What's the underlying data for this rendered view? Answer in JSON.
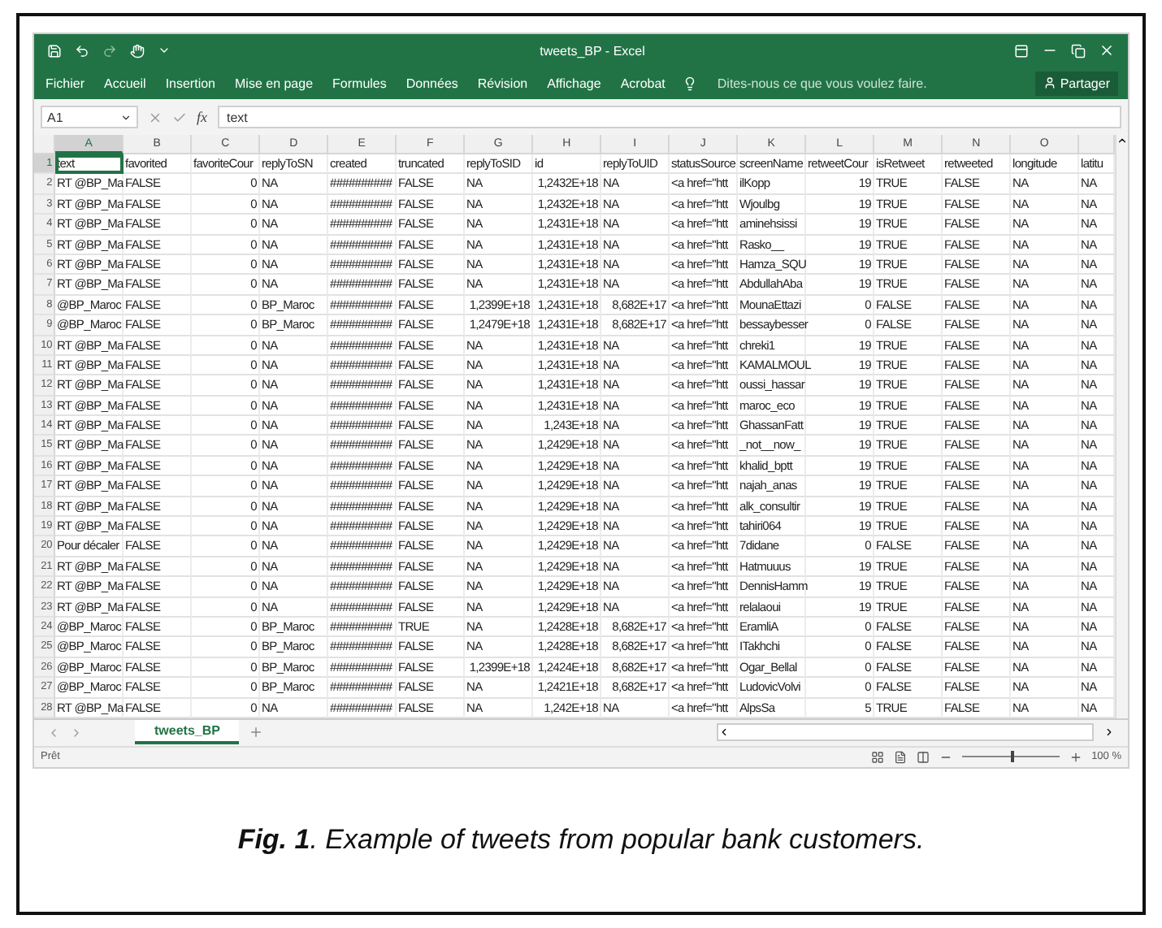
{
  "window": {
    "title": "tweets_BP - Excel"
  },
  "ribbon_tabs": [
    {
      "label": "Fichier",
      "selected": false
    },
    {
      "label": "Accueil",
      "selected": false
    },
    {
      "label": "Insertion",
      "selected": false
    },
    {
      "label": "Mise en page",
      "selected": false
    },
    {
      "label": "Formules",
      "selected": false
    },
    {
      "label": "Données",
      "selected": false
    },
    {
      "label": "Révision",
      "selected": false
    },
    {
      "label": "Affichage",
      "selected": false
    },
    {
      "label": "Acrobat",
      "selected": false
    }
  ],
  "tell_me": {
    "placeholder": "Dites-nous ce que vous voulez faire."
  },
  "share": "Partager",
  "formula_bar": {
    "name_box": "A1",
    "fx": "fx",
    "value": "text"
  },
  "columns": [
    {
      "label": "A",
      "selected": true
    },
    {
      "label": "B",
      "selected": false
    },
    {
      "label": "C",
      "selected": false
    },
    {
      "label": "D",
      "selected": false
    },
    {
      "label": "E",
      "selected": false
    },
    {
      "label": "F",
      "selected": false
    },
    {
      "label": "G",
      "selected": false
    },
    {
      "label": "H",
      "selected": false
    },
    {
      "label": "I",
      "selected": false
    },
    {
      "label": "J",
      "selected": false
    },
    {
      "label": "K",
      "selected": false
    },
    {
      "label": "L",
      "selected": false
    },
    {
      "label": "M",
      "selected": false
    },
    {
      "label": "N",
      "selected": false
    },
    {
      "label": "O",
      "selected": false
    }
  ],
  "rows": [
    {
      "number": "1",
      "selected": true,
      "cells": [
        "text",
        "favorited",
        "favoriteCour",
        "replyToSN",
        "created",
        "truncated",
        "replyToSID",
        "id",
        "replyToUID",
        "statusSource",
        "screenName",
        "retweetCour",
        "isRetweet",
        "retweeted",
        "longitude",
        "latitu"
      ]
    },
    {
      "number": "2",
      "selected": false,
      "cells": [
        "RT @BP_Ma",
        "FALSE",
        "0",
        "NA",
        "##########",
        "FALSE",
        "NA",
        "1,2432E+18",
        "NA",
        "<a href=\"htt",
        "ilKopp",
        "19",
        "TRUE",
        "FALSE",
        "NA",
        "NA"
      ]
    },
    {
      "number": "3",
      "selected": false,
      "cells": [
        "RT @BP_Ma",
        "FALSE",
        "0",
        "NA",
        "##########",
        "FALSE",
        "NA",
        "1,2432E+18",
        "NA",
        "<a href=\"htt",
        "Wjoulbg",
        "19",
        "TRUE",
        "FALSE",
        "NA",
        "NA"
      ]
    },
    {
      "number": "4",
      "selected": false,
      "cells": [
        "RT @BP_Ma",
        "FALSE",
        "0",
        "NA",
        "##########",
        "FALSE",
        "NA",
        "1,2431E+18",
        "NA",
        "<a href=\"htt",
        "aminehsissi",
        "19",
        "TRUE",
        "FALSE",
        "NA",
        "NA"
      ]
    },
    {
      "number": "5",
      "selected": false,
      "cells": [
        "RT @BP_Ma",
        "FALSE",
        "0",
        "NA",
        "##########",
        "FALSE",
        "NA",
        "1,2431E+18",
        "NA",
        "<a href=\"htt",
        "Rasko__",
        "19",
        "TRUE",
        "FALSE",
        "NA",
        "NA"
      ]
    },
    {
      "number": "6",
      "selected": false,
      "cells": [
        "RT @BP_Ma",
        "FALSE",
        "0",
        "NA",
        "##########",
        "FALSE",
        "NA",
        "1,2431E+18",
        "NA",
        "<a href=\"htt",
        "Hamza_SQU",
        "19",
        "TRUE",
        "FALSE",
        "NA",
        "NA"
      ]
    },
    {
      "number": "7",
      "selected": false,
      "cells": [
        "RT @BP_Ma",
        "FALSE",
        "0",
        "NA",
        "##########",
        "FALSE",
        "NA",
        "1,2431E+18",
        "NA",
        "<a href=\"htt",
        "AbdullahAba",
        "19",
        "TRUE",
        "FALSE",
        "NA",
        "NA"
      ]
    },
    {
      "number": "8",
      "selected": false,
      "cells": [
        "@BP_Maroc",
        "FALSE",
        "0",
        "BP_Maroc",
        "##########",
        "FALSE",
        "1,2399E+18",
        "1,2431E+18",
        "8,682E+17",
        "<a href=\"htt",
        "MounaEttazi",
        "0",
        "FALSE",
        "FALSE",
        "NA",
        "NA"
      ]
    },
    {
      "number": "9",
      "selected": false,
      "cells": [
        "@BP_Maroc",
        "FALSE",
        "0",
        "BP_Maroc",
        "##########",
        "FALSE",
        "1,2479E+18",
        "1,2431E+18",
        "8,682E+17",
        "<a href=\"htt",
        "bessaybesser",
        "0",
        "FALSE",
        "FALSE",
        "NA",
        "NA"
      ]
    },
    {
      "number": "10",
      "selected": false,
      "cells": [
        "RT @BP_Ma",
        "FALSE",
        "0",
        "NA",
        "##########",
        "FALSE",
        "NA",
        "1,2431E+18",
        "NA",
        "<a href=\"htt",
        "chreki1",
        "19",
        "TRUE",
        "FALSE",
        "NA",
        "NA"
      ]
    },
    {
      "number": "11",
      "selected": false,
      "cells": [
        "RT @BP_Ma",
        "FALSE",
        "0",
        "NA",
        "##########",
        "FALSE",
        "NA",
        "1,2431E+18",
        "NA",
        "<a href=\"htt",
        "KAMALMOUL",
        "19",
        "TRUE",
        "FALSE",
        "NA",
        "NA"
      ]
    },
    {
      "number": "12",
      "selected": false,
      "cells": [
        "RT @BP_Ma",
        "FALSE",
        "0",
        "NA",
        "##########",
        "FALSE",
        "NA",
        "1,2431E+18",
        "NA",
        "<a href=\"htt",
        "oussi_hassar",
        "19",
        "TRUE",
        "FALSE",
        "NA",
        "NA"
      ]
    },
    {
      "number": "13",
      "selected": false,
      "cells": [
        "RT @BP_Ma",
        "FALSE",
        "0",
        "NA",
        "##########",
        "FALSE",
        "NA",
        "1,2431E+18",
        "NA",
        "<a href=\"htt",
        "maroc_eco",
        "19",
        "TRUE",
        "FALSE",
        "NA",
        "NA"
      ]
    },
    {
      "number": "14",
      "selected": false,
      "cells": [
        "RT @BP_Ma",
        "FALSE",
        "0",
        "NA",
        "##########",
        "FALSE",
        "NA",
        "1,243E+18",
        "NA",
        "<a href=\"htt",
        "GhassanFatt",
        "19",
        "TRUE",
        "FALSE",
        "NA",
        "NA"
      ]
    },
    {
      "number": "15",
      "selected": false,
      "cells": [
        "RT @BP_Ma",
        "FALSE",
        "0",
        "NA",
        "##########",
        "FALSE",
        "NA",
        "1,2429E+18",
        "NA",
        "<a href=\"htt",
        "_not__now_",
        "19",
        "TRUE",
        "FALSE",
        "NA",
        "NA"
      ]
    },
    {
      "number": "16",
      "selected": false,
      "cells": [
        "RT @BP_Ma",
        "FALSE",
        "0",
        "NA",
        "##########",
        "FALSE",
        "NA",
        "1,2429E+18",
        "NA",
        "<a href=\"htt",
        "khalid_bptt",
        "19",
        "TRUE",
        "FALSE",
        "NA",
        "NA"
      ]
    },
    {
      "number": "17",
      "selected": false,
      "cells": [
        "RT @BP_Ma",
        "FALSE",
        "0",
        "NA",
        "##########",
        "FALSE",
        "NA",
        "1,2429E+18",
        "NA",
        "<a href=\"htt",
        "najah_anas",
        "19",
        "TRUE",
        "FALSE",
        "NA",
        "NA"
      ]
    },
    {
      "number": "18",
      "selected": false,
      "cells": [
        "RT @BP_Ma",
        "FALSE",
        "0",
        "NA",
        "##########",
        "FALSE",
        "NA",
        "1,2429E+18",
        "NA",
        "<a href=\"htt",
        "alk_consultir",
        "19",
        "TRUE",
        "FALSE",
        "NA",
        "NA"
      ]
    },
    {
      "number": "19",
      "selected": false,
      "cells": [
        "RT @BP_Ma",
        "FALSE",
        "0",
        "NA",
        "##########",
        "FALSE",
        "NA",
        "1,2429E+18",
        "NA",
        "<a href=\"htt",
        "tahiri064",
        "19",
        "TRUE",
        "FALSE",
        "NA",
        "NA"
      ]
    },
    {
      "number": "20",
      "selected": false,
      "cells": [
        "Pour décaler",
        "FALSE",
        "0",
        "NA",
        "##########",
        "FALSE",
        "NA",
        "1,2429E+18",
        "NA",
        "<a href=\"htt",
        "7didane",
        "0",
        "FALSE",
        "FALSE",
        "NA",
        "NA"
      ]
    },
    {
      "number": "21",
      "selected": false,
      "cells": [
        "RT @BP_Ma",
        "FALSE",
        "0",
        "NA",
        "##########",
        "FALSE",
        "NA",
        "1,2429E+18",
        "NA",
        "<a href=\"htt",
        "Hatmuuus",
        "19",
        "TRUE",
        "FALSE",
        "NA",
        "NA"
      ]
    },
    {
      "number": "22",
      "selected": false,
      "cells": [
        "RT @BP_Ma",
        "FALSE",
        "0",
        "NA",
        "##########",
        "FALSE",
        "NA",
        "1,2429E+18",
        "NA",
        "<a href=\"htt",
        "DennisHamm",
        "19",
        "TRUE",
        "FALSE",
        "NA",
        "NA"
      ]
    },
    {
      "number": "23",
      "selected": false,
      "cells": [
        "RT @BP_Ma",
        "FALSE",
        "0",
        "NA",
        "##########",
        "FALSE",
        "NA",
        "1,2429E+18",
        "NA",
        "<a href=\"htt",
        "relalaoui",
        "19",
        "TRUE",
        "FALSE",
        "NA",
        "NA"
      ]
    },
    {
      "number": "24",
      "selected": false,
      "cells": [
        "@BP_Maroc",
        "FALSE",
        "0",
        "BP_Maroc",
        "##########",
        "TRUE",
        "NA",
        "1,2428E+18",
        "8,682E+17",
        "<a href=\"htt",
        "EramliA",
        "0",
        "FALSE",
        "FALSE",
        "NA",
        "NA"
      ]
    },
    {
      "number": "25",
      "selected": false,
      "cells": [
        "@BP_Maroc",
        "FALSE",
        "0",
        "BP_Maroc",
        "##########",
        "FALSE",
        "NA",
        "1,2428E+18",
        "8,682E+17",
        "<a href=\"htt",
        "ITakhchi",
        "0",
        "FALSE",
        "FALSE",
        "NA",
        "NA"
      ]
    },
    {
      "number": "26",
      "selected": false,
      "cells": [
        "@BP_Maroc",
        "FALSE",
        "0",
        "BP_Maroc",
        "##########",
        "FALSE",
        "1,2399E+18",
        "1,2424E+18",
        "8,682E+17",
        "<a href=\"htt",
        "Ogar_Bellal",
        "0",
        "FALSE",
        "FALSE",
        "NA",
        "NA"
      ]
    },
    {
      "number": "27",
      "selected": false,
      "cells": [
        "@BP_Maroc",
        "FALSE",
        "0",
        "BP_Maroc",
        "##########",
        "FALSE",
        "NA",
        "1,2421E+18",
        "8,682E+17",
        "<a href=\"htt",
        "LudovicVolvi",
        "0",
        "FALSE",
        "FALSE",
        "NA",
        "NA"
      ]
    },
    {
      "number": "28",
      "selected": false,
      "cells": [
        "RT @BP_Ma",
        "FALSE",
        "0",
        "NA",
        "##########",
        "FALSE",
        "NA",
        "1,242E+18",
        "NA",
        "<a href=\"htt",
        "AlpsSa",
        "5",
        "TRUE",
        "FALSE",
        "NA",
        "NA"
      ]
    }
  ],
  "sheet_tabs": [
    {
      "label": "tweets_BP",
      "selected": true
    }
  ],
  "status_bar": {
    "status": "Prêt",
    "zoom": "100 %",
    "zoom_level": {
      "level": 0.5
    }
  },
  "caption": "**Fig. 1**. Example of tweets from popular bank customers."
}
